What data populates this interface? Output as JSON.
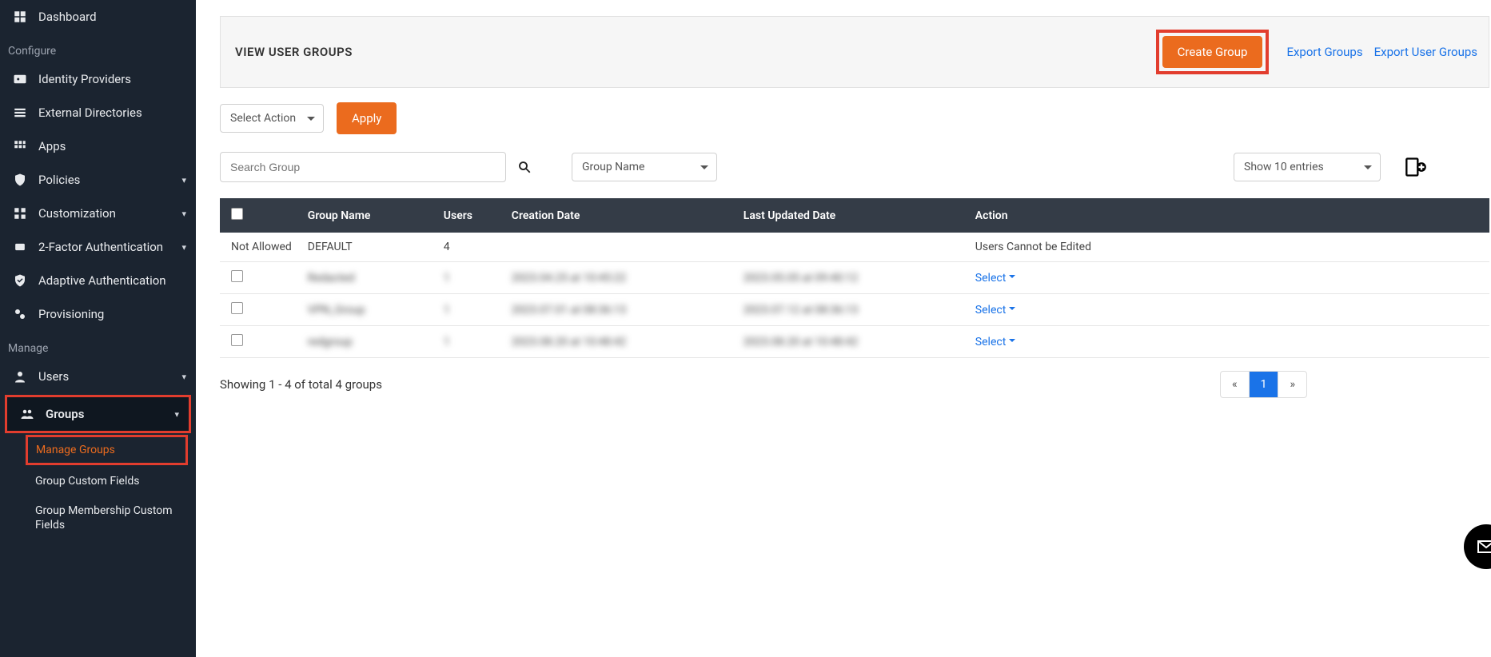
{
  "sidebar": {
    "configure_label": "Configure",
    "manage_label": "Manage",
    "items": {
      "dashboard": "Dashboard",
      "idp": "Identity Providers",
      "ext_dir": "External Directories",
      "apps": "Apps",
      "policies": "Policies",
      "customization": "Customization",
      "two_factor": "2-Factor Authentication",
      "adaptive": "Adaptive Authentication",
      "provisioning": "Provisioning",
      "users": "Users",
      "groups": "Groups"
    },
    "subitems": {
      "manage_groups": "Manage Groups",
      "group_custom_fields": "Group Custom Fields",
      "group_membership_custom_fields": "Group Membership Custom Fields"
    }
  },
  "header": {
    "title": "VIEW USER GROUPS",
    "create_group": "Create Group",
    "export_groups": "Export Groups",
    "export_user_groups": "Export User Groups"
  },
  "toolbar": {
    "select_action": "Select Action",
    "apply": "Apply"
  },
  "search": {
    "placeholder": "Search Group",
    "filter_by": "Group Name",
    "show_entries": "Show 10 entries"
  },
  "table": {
    "headers": {
      "group_name": "Group Name",
      "users": "Users",
      "creation_date": "Creation Date",
      "last_updated": "Last Updated Date",
      "action": "Action"
    },
    "rows": [
      {
        "checkbox_text": "Not Allowed",
        "name": "DEFAULT",
        "users": "4",
        "users_link": true,
        "created": "",
        "updated": "",
        "action_text": "Users Cannot be Edited",
        "action_is_select": false,
        "blurred": false
      },
      {
        "checkbox_text": "",
        "name": "Redacted",
        "users": "1",
        "users_link": false,
        "created": "2023.04.25 at 10:45:22",
        "updated": "2023.05.05 at 09:40:12",
        "action_text": "Select",
        "action_is_select": true,
        "blurred": true
      },
      {
        "checkbox_text": "",
        "name": "VPN_Group",
        "users": "1",
        "users_link": false,
        "created": "2023.07.01 at 08:36:13",
        "updated": "2023.07.12 at 08:36:13",
        "action_text": "Select",
        "action_is_select": true,
        "blurred": true
      },
      {
        "checkbox_text": "",
        "name": "redgroup",
        "users": "1",
        "users_link": false,
        "created": "2023.08.20 at 10:48:42",
        "updated": "2023.08.20 at 10:48:42",
        "action_text": "Select",
        "action_is_select": true,
        "blurred": true
      }
    ]
  },
  "footer": {
    "showing": "Showing 1 - 4 of total 4 groups",
    "prev": "«",
    "page": "1",
    "next": "»"
  }
}
